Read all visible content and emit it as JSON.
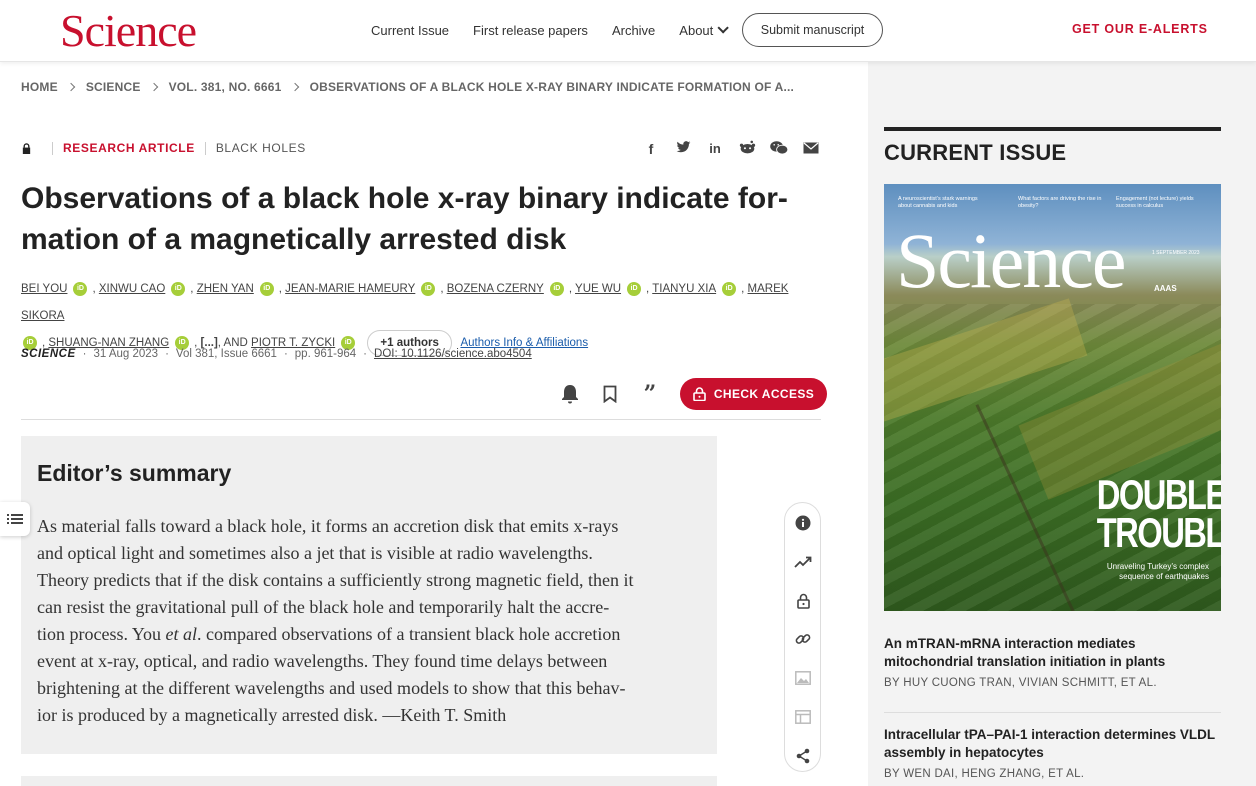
{
  "header": {
    "logo": "Science",
    "nav": [
      "Current Issue",
      "First release papers",
      "Archive",
      "About"
    ],
    "submit": "Submit manuscript",
    "ealerts": "GET OUR E-ALERTS"
  },
  "breadcrumb": [
    "HOME",
    "SCIENCE",
    "VOL. 381, NO. 6661",
    "OBSERVATIONS OF A BLACK HOLE X-RAY BINARY INDICATE FORMATION OF A..."
  ],
  "article": {
    "type": "RESEARCH ARTICLE",
    "topic": "BLACK HOLES",
    "title": "Observations of a black hole x-ray binary indicate for­mation of a magnetically arrested disk",
    "title_line1": "Observations of a black hole x-ray binary indicate for-",
    "title_line2": "mation of a magnetically arrested disk",
    "authors": [
      "BEI YOU",
      "XINWU CAO",
      "ZHEN YAN",
      "JEAN-MARIE HAMEURY",
      "BOZENA CZERNY",
      "YUE WU",
      "TIANYU XIA",
      "MAREK SIKORA",
      "SHUANG-NAN ZHANG",
      "PIOTR T. ZYCKI"
    ],
    "ellipsis": "[...]",
    "and": ", AND",
    "more_authors": "+1 authors",
    "affiliations": "Authors Info & Affiliations",
    "journal": "SCIENCE",
    "date": "31 Aug 2023",
    "volume": "Vol 381, Issue 6661",
    "pages": "pp. 961-964",
    "doi": "DOI: 10.1126/science.abo4504",
    "check_access": "CHECK ACCESS"
  },
  "summary": {
    "heading": "Editor’s summary",
    "lines": [
      "As material falls toward a black hole, it forms an accretion disk that emits x-rays",
      "and optical light and sometimes also a jet that is visible at radio wavelengths.",
      "Theory predicts that if the disk contains a sufficiently strong magnetic field, then it",
      "can resist the gravitational pull of the black hole and temporarily halt the accre-",
      "tion process. You ",
      "et al",
      ". compared observations of a transient black hole accretion",
      "event at x-ray, optical, and radio wavelengths. They found time delays between",
      "brightening at the different wavelengths and used models to show that this behav-",
      "ior is produced by a magnetically arrested disk. —Keith T. Smith"
    ]
  },
  "sidebar": {
    "heading": "CURRENT ISSUE",
    "cover": {
      "logo": "Science",
      "teasers": [
        "A neuroscientist’s stark warnings about cannabis and kids",
        "What factors are driving the rise in obesity?",
        "Engagement (not lecture) yields success in calculus"
      ],
      "date": "1 SEPTEMBER 2023",
      "publisher": "AAAS",
      "headline1": "DOUBLE",
      "headline2": "TROUBLE",
      "subhead": "Unraveling Turkey’s complex sequence of earthquakes"
    },
    "articles": [
      {
        "title": "An mTRAN-mRNA interaction mediates mitochondrial translation initiation in plants",
        "authors": "BY HUY CUONG TRAN, VIVIAN SCHMITT, ET AL."
      },
      {
        "title": "Intracellular tPA–PAI-1 interaction determines VLDL assembly in hepatocytes",
        "authors": "BY WEN DAI, HENG ZHANG, ET AL."
      }
    ]
  },
  "colors": {
    "brand": "#c8102e",
    "orcid": "#a6ce39",
    "link": "#1a5cab"
  }
}
